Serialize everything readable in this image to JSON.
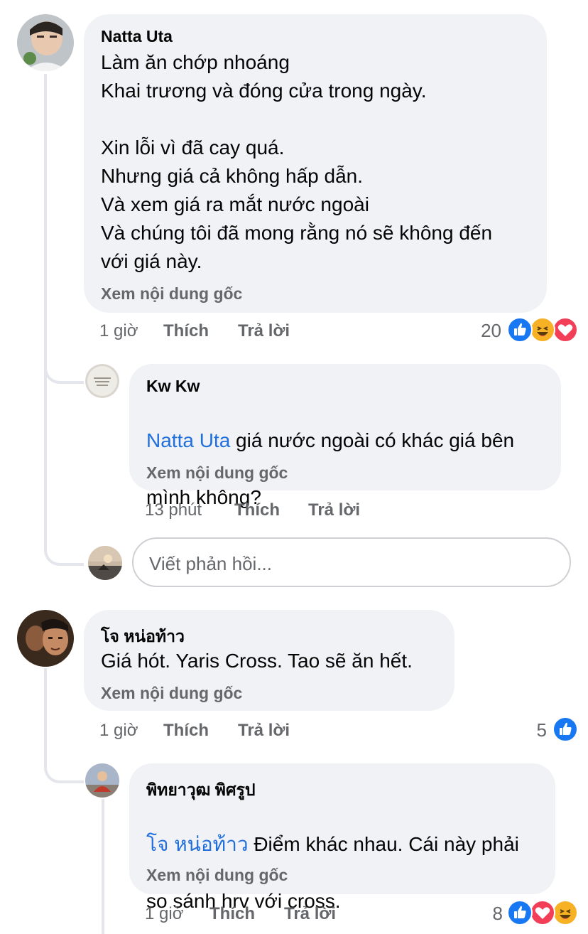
{
  "comments": [
    {
      "author": "Natta Uta",
      "text": "Làm ăn chớp nhoáng\nKhai trương và đóng cửa trong ngày.\n\nXin lỗi vì đã cay quá.\nNhưng giá cả không hấp dẫn.\nVà xem giá ra mắt nước ngoài\nVà chúng tôi đã mong rằng nó sẽ không đến\nvới giá này.",
      "see_original": "Xem nội dung gốc",
      "time": "1 giờ",
      "like": "Thích",
      "reply": "Trả lời",
      "reaction_count": "20",
      "reactions": [
        "like-icon",
        "haha-icon",
        "love-icon"
      ],
      "replies": [
        {
          "author": "Kw Kw",
          "mention": "Natta Uta",
          "text_line1": " giá nước ngoài có khác giá bên",
          "text_line2": "mình không?",
          "see_original": "Xem nội dung gốc",
          "time": "13 phút",
          "like": "Thích",
          "reply": "Trả lời"
        }
      ],
      "reply_placeholder": "Viết phản hồi..."
    },
    {
      "author": "โจ หน่อท้าว",
      "text": "Giá hót. Yaris Cross. Tao sẽ ăn hết.",
      "see_original": "Xem nội dung gốc",
      "time": "1 giờ",
      "like": "Thích",
      "reply": "Trả lời",
      "reaction_count": "5",
      "reactions": [
        "like-icon"
      ],
      "replies": [
        {
          "author": "พิทยาวุฒ พิศรูป",
          "mention": "โจ หน่อท้าว",
          "text_line1": " Điểm khác nhau. Cái này phải",
          "text_line2": "so sánh hrv với cross.",
          "see_original": "Xem nội dung gốc",
          "time": "1 giờ",
          "like": "Thích",
          "reply": "Trả lời",
          "reaction_count": "8",
          "reactions": [
            "like-icon",
            "love-icon",
            "haha-icon"
          ]
        }
      ]
    }
  ],
  "colors": {
    "bubble": "#f0f2f5",
    "meta_text": "#65676b",
    "mention": "#216fdb",
    "like_blue": "#1877f2",
    "love_red": "#f33e58",
    "haha_yellow": "#f7b125"
  }
}
